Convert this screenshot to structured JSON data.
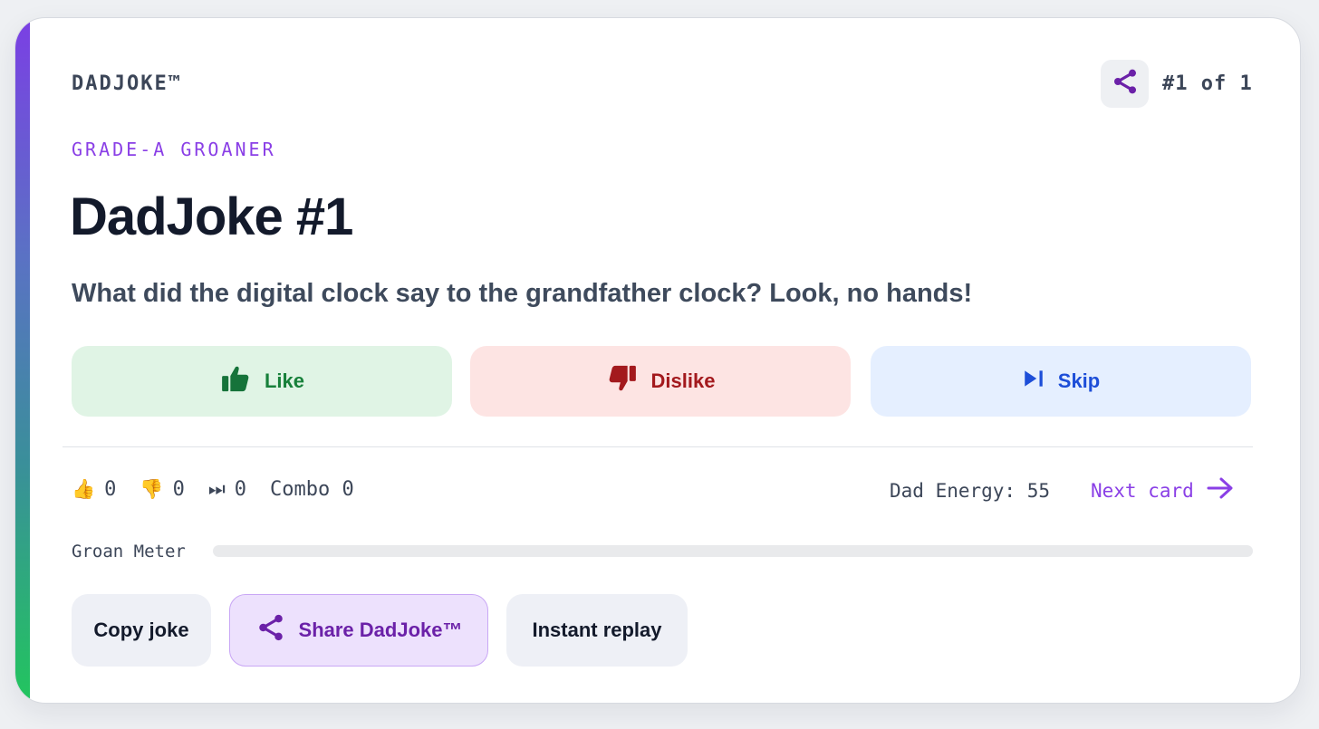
{
  "brand": "DADJOKE™",
  "counter": "#1 of 1",
  "tag": "GRADE-A GROANER",
  "title": "DadJoke #1",
  "joke": "What did the digital clock say to the grandfather clock? Look, no hands!",
  "actions": {
    "like": "Like",
    "dislike": "Dislike",
    "skip": "Skip"
  },
  "stats": {
    "likes_emoji": "👍",
    "likes": "0",
    "dislikes_emoji": "👎",
    "dislikes": "0",
    "skips_emoji": "⏭",
    "skips": "0",
    "combo": "Combo 0"
  },
  "dad_energy": "Dad Energy: 55",
  "next_card": "Next card",
  "groan_meter": {
    "label": "Groan Meter",
    "value": 0
  },
  "buttons": {
    "copy": "Copy joke",
    "share": "Share DadJoke™",
    "replay": "Instant replay"
  },
  "icons": {
    "share": "share-icon",
    "like": "thumbs-up-icon",
    "dislike": "thumbs-down-icon",
    "skip": "skip-next-icon",
    "next": "arrow-right-icon"
  },
  "colors": {
    "accent": "#8a3fe6",
    "like": "#17803a",
    "dislike": "#a3191d",
    "skip": "#1d4ed8"
  }
}
